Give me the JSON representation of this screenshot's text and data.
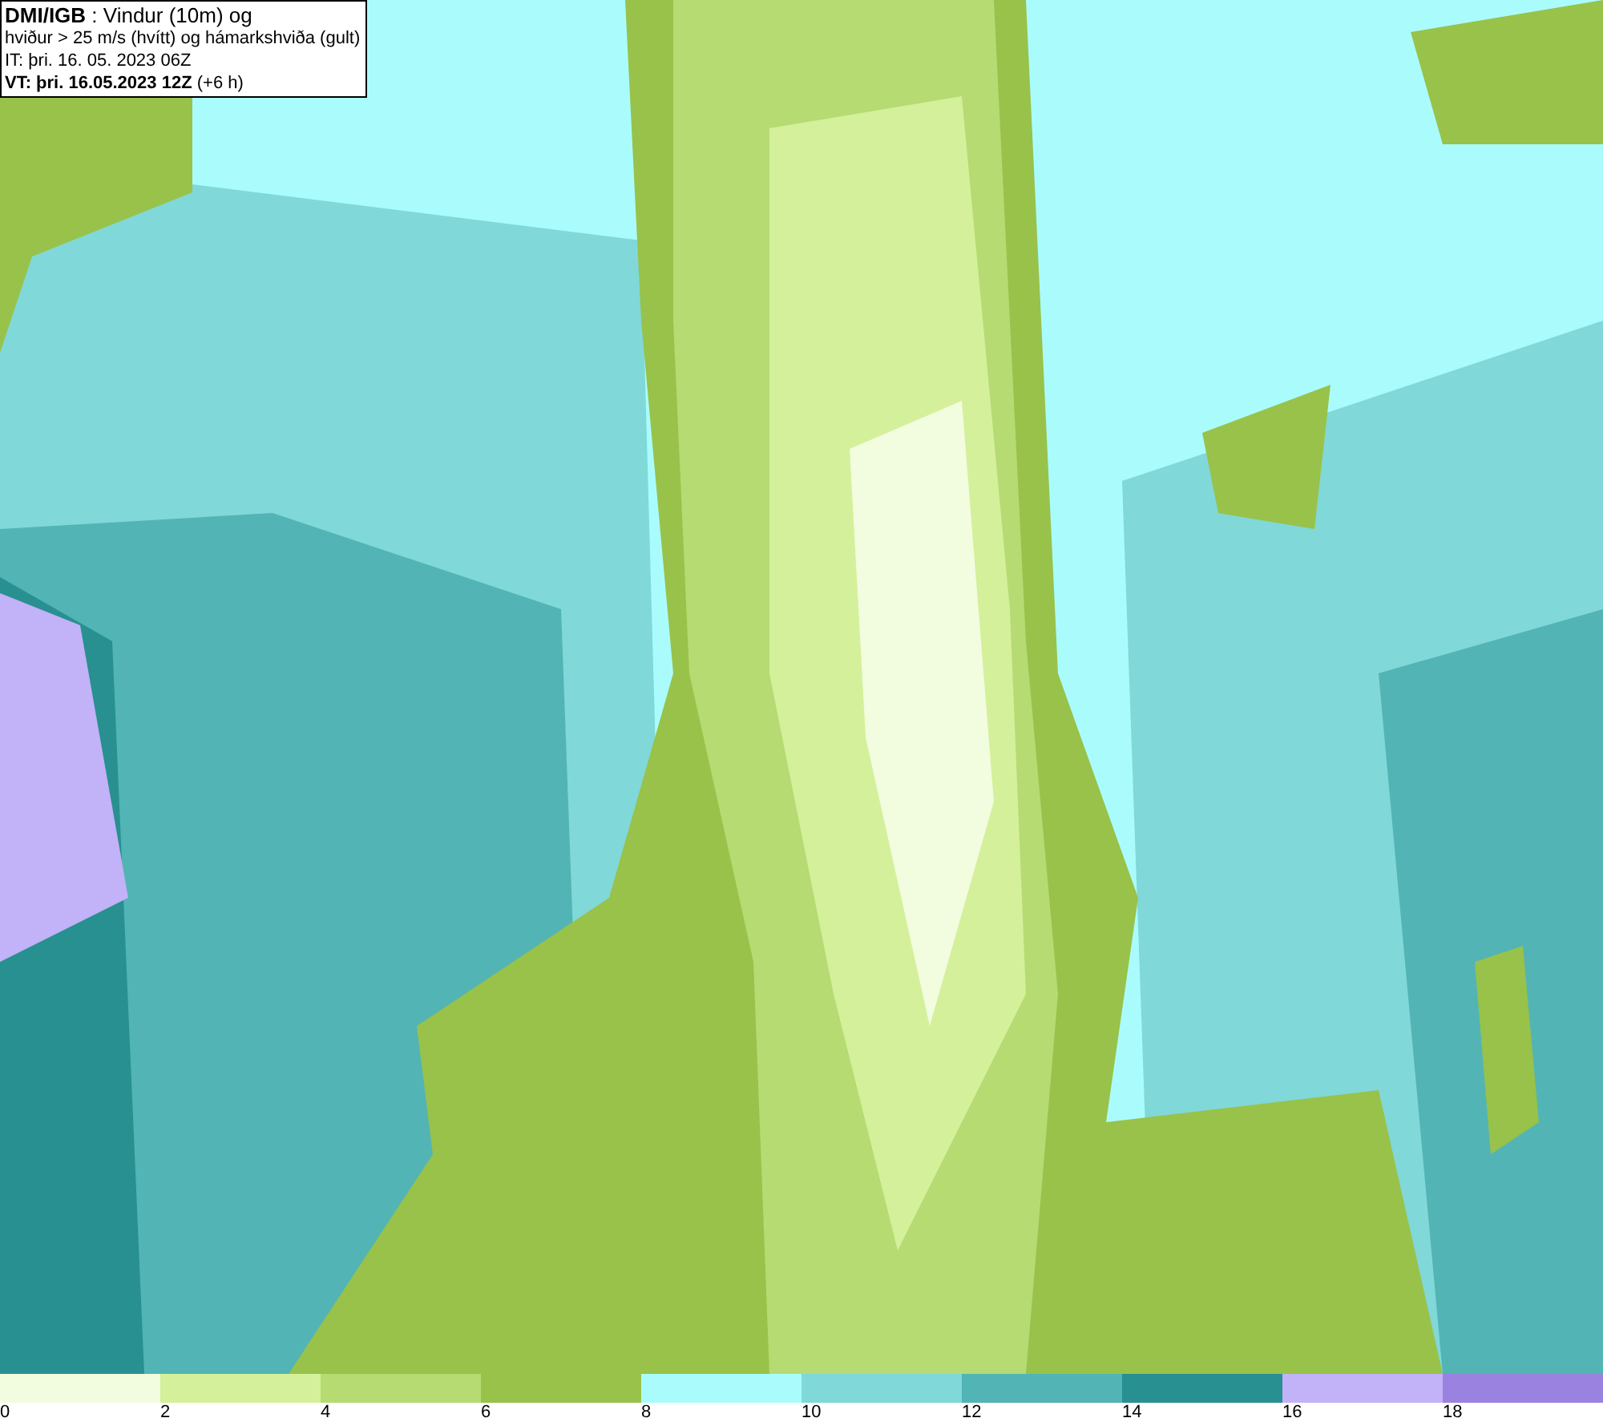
{
  "info_box": {
    "lines": [
      "**DMI/IGB** : Vindur (10m) og",
      "hviður > 25 m/s (hvítt) og hámarkshviða (gult)",
      "IT: þri. 16. 05. 2023 06Z",
      "**VT: þri. 16.05.2023 12Z** (+6 h)"
    ]
  },
  "legend": [
    {
      "label": "0",
      "color": "#f2fcdf"
    },
    {
      "label": "2",
      "color": "#d4f09a"
    },
    {
      "label": "4",
      "color": "#b5db72"
    },
    {
      "label": "6",
      "color": "#98c24a"
    },
    {
      "label": "8",
      "color": "#aafcfc"
    },
    {
      "label": "10",
      "color": "#80d8d8"
    },
    {
      "label": "12",
      "color": "#52b4b4"
    },
    {
      "label": "14",
      "color": "#289090"
    },
    {
      "label": "16",
      "color": "#c2b2f8"
    },
    {
      "label": "18",
      "color": "#9a82e0"
    }
  ]
}
